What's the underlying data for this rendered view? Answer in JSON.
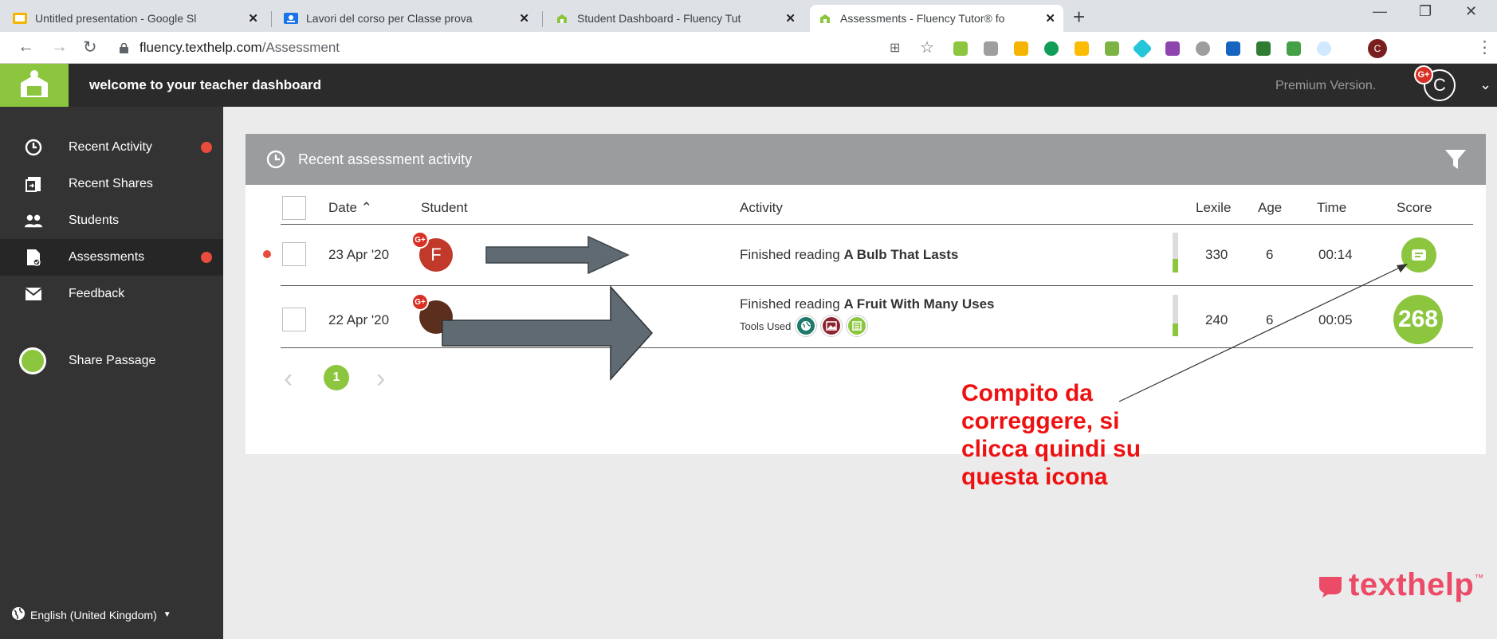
{
  "browser": {
    "tabs": [
      {
        "label": "Untitled presentation - Google Sl",
        "icon": "slides-icon",
        "color": "#f4b400"
      },
      {
        "label": "Lavori del corso per Classe prova",
        "icon": "classroom-icon",
        "color": "#1a73e8"
      },
      {
        "label": "Student Dashboard - Fluency Tut",
        "icon": "fluency-icon",
        "color": "#8cc63f"
      },
      {
        "label": "Assessments - Fluency Tutor® fo",
        "icon": "fluency-icon",
        "color": "#8cc63f",
        "active": true
      }
    ],
    "new_tab": "+",
    "url_host": "fluency.texthelp.com",
    "url_path": "/Assessment",
    "profile_initial": "C"
  },
  "header": {
    "welcome": "welcome to your teacher dashboard",
    "premium": "Premium Version.",
    "avatar_initial": "C",
    "gplus_badge": "G+"
  },
  "sidebar": {
    "items": [
      {
        "label": "Recent Activity",
        "icon": "clock-icon",
        "alert": true
      },
      {
        "label": "Recent Shares",
        "icon": "share-icon",
        "alert": false
      },
      {
        "label": "Students",
        "icon": "users-icon",
        "alert": false
      },
      {
        "label": "Assessments",
        "icon": "assessment-icon",
        "alert": true,
        "active": true
      },
      {
        "label": "Feedback",
        "icon": "mail-icon",
        "alert": false
      }
    ],
    "share_passage": "Share Passage",
    "language": "English (United Kingdom)"
  },
  "panel": {
    "title": "Recent assessment activity",
    "columns": {
      "date": "Date",
      "student": "Student",
      "activity": "Activity",
      "lexile": "Lexile",
      "age": "Age",
      "time": "Time",
      "score": "Score"
    },
    "rows": [
      {
        "date": "23 Apr '20",
        "student_initial": "F",
        "activity_prefix": "Finished reading",
        "activity_title": "A Bulb That Lasts",
        "lexile": "330",
        "age": "6",
        "time": "00:14",
        "score": "",
        "unread": true,
        "avatar_color": "#c0392b",
        "bar_fill": 0.35
      },
      {
        "date": "22 Apr '20",
        "student_initial": "",
        "activity_prefix": "Finished reading",
        "activity_title": "A Fruit With Many Uses",
        "tools_label": "Tools Used",
        "lexile": "240",
        "age": "6",
        "time": "00:05",
        "score": "268",
        "unread": false,
        "avatar_color": "#5b2e1e",
        "bar_fill": 0.3
      }
    ],
    "tools": [
      "dictionary-icon",
      "picture-icon",
      "notes-icon"
    ],
    "page": "1"
  },
  "annotation": {
    "text_lines": [
      "Compito da",
      "correggere, si",
      "clicca quindi su",
      "questa icona"
    ],
    "color": "#ee1111"
  },
  "brand": {
    "name": "texthelp",
    "tm": "™",
    "color": "#ec4b67"
  }
}
